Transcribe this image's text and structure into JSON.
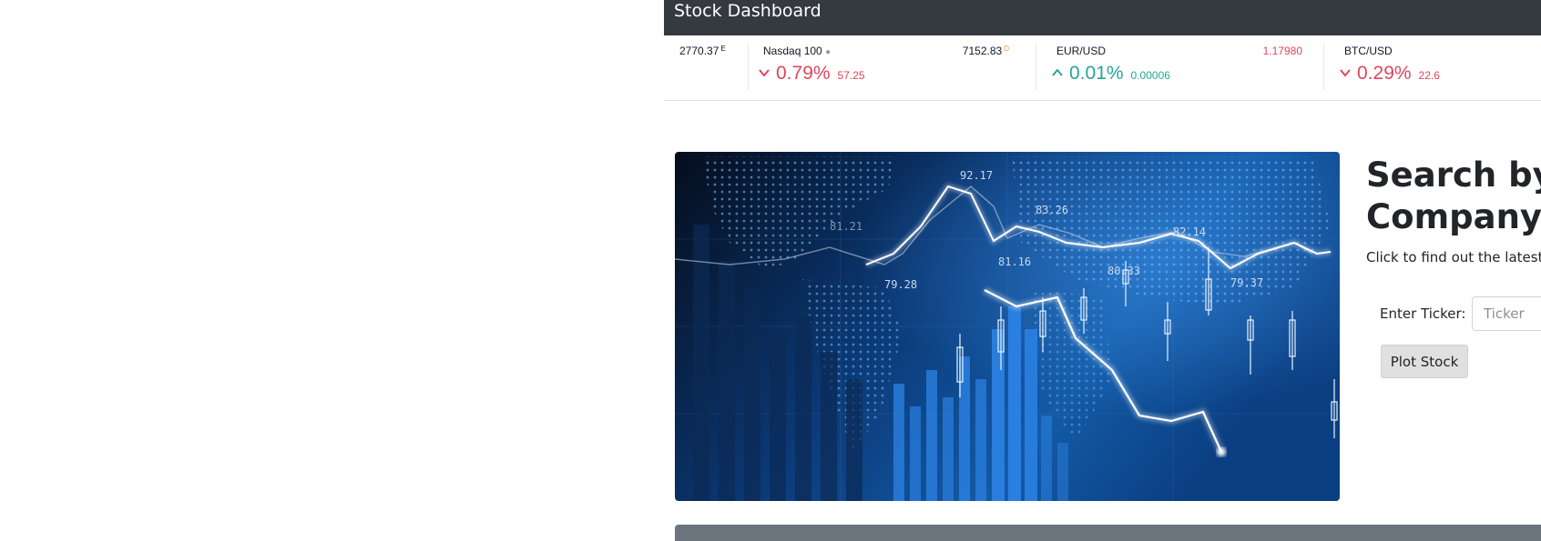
{
  "navbar": {
    "brand": "Stock Dashboard"
  },
  "ticker_tape": {
    "partial_first": {
      "price": "2770.37",
      "price_flag": "E"
    },
    "items": [
      {
        "name": "Nasdaq 100",
        "price": "7152.83",
        "price_flag": "D",
        "direction": "down",
        "change_pct": "0.79%",
        "change_abs": "57.25"
      },
      {
        "name": "EUR/USD",
        "price": "1.17980",
        "price_flag": "",
        "direction": "up",
        "change_pct": "0.01%",
        "change_abs": "0.00006"
      },
      {
        "name": "BTC/USD",
        "price": "",
        "price_flag": "",
        "direction": "down",
        "change_pct": "0.29%",
        "change_abs": "22.6"
      }
    ],
    "colors": {
      "down": "#e0455c",
      "up": "#26a69a",
      "flag_delayed": "#f59d2a"
    }
  },
  "hero_image": {
    "labels": [
      "92.17",
      "83.26",
      "81.21",
      "82.14",
      "81.16",
      "80.33",
      "79.28",
      "79.37"
    ]
  },
  "search": {
    "title_line1": "Search by",
    "title_line2": "Company T",
    "subtitle": "Click to find out the latest",
    "ticker_label": "Enter Ticker:",
    "ticker_placeholder": "Ticker",
    "button_label": "Plot Stock"
  }
}
